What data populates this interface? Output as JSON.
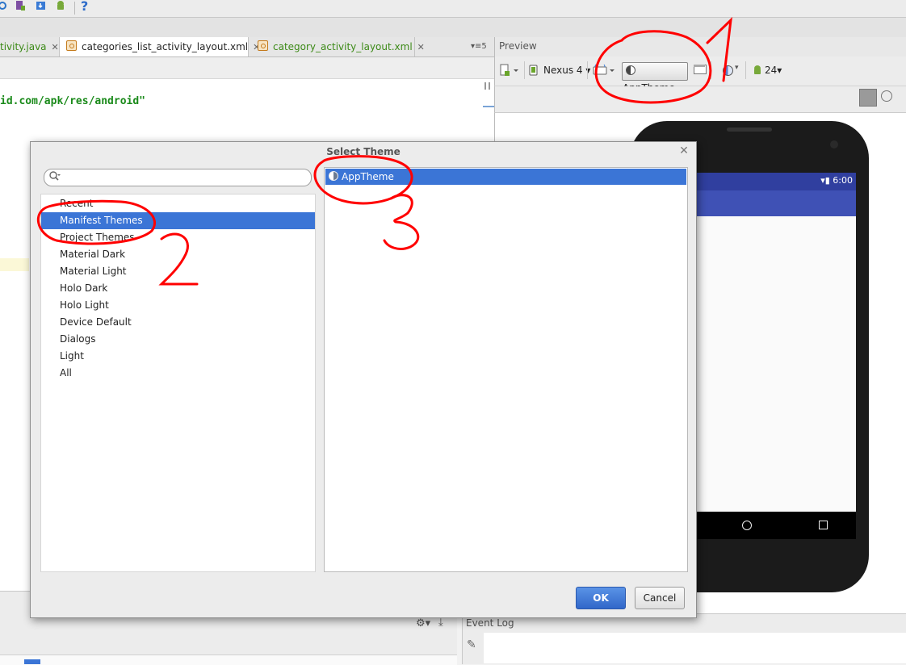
{
  "tabs": [
    {
      "label": "tivity.java",
      "active": false
    },
    {
      "label": "categories_list_activity_layout.xml",
      "active": true
    },
    {
      "label": "category_activity_layout.xml",
      "active": false
    }
  ],
  "tabs_overflow": "5",
  "editor": {
    "code_line": "id.com/apk/res/android\""
  },
  "preview": {
    "title": "Preview",
    "device": "Nexus 4",
    "theme_button": "AppTheme",
    "api_level": "24"
  },
  "phone": {
    "status_time": "6:00"
  },
  "dialog": {
    "title": "Select Theme",
    "search_placeholder": "",
    "categories": [
      {
        "label": "Recent",
        "selected": false
      },
      {
        "label": "Manifest Themes",
        "selected": true
      },
      {
        "label": "Project Themes",
        "selected": false
      },
      {
        "label": "Material Dark",
        "selected": false
      },
      {
        "label": "Material Light",
        "selected": false
      },
      {
        "label": "Holo Dark",
        "selected": false
      },
      {
        "label": "Holo Light",
        "selected": false
      },
      {
        "label": "Device Default",
        "selected": false
      },
      {
        "label": "Dialogs",
        "selected": false
      },
      {
        "label": "Light",
        "selected": false
      },
      {
        "label": "All",
        "selected": false
      }
    ],
    "themes": [
      {
        "label": "AppTheme",
        "selected": true
      }
    ],
    "ok_label": "OK",
    "cancel_label": "Cancel"
  },
  "event_log": {
    "title": "Event Log"
  },
  "annotations": {
    "color": "#ff0000",
    "labels": [
      "1",
      "2",
      "3"
    ]
  }
}
